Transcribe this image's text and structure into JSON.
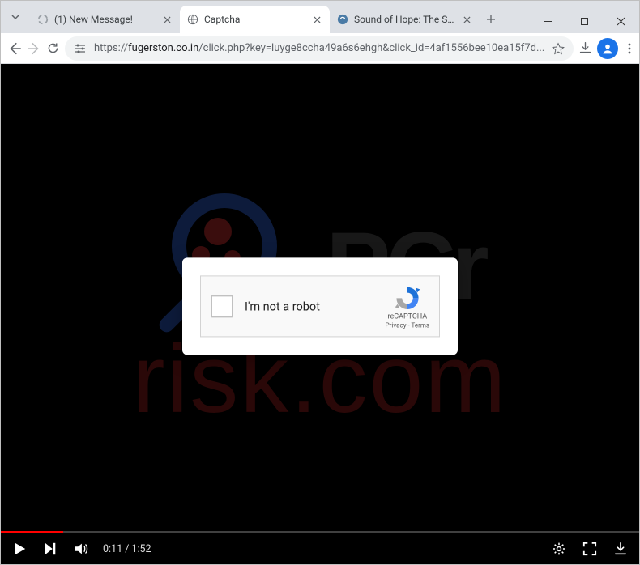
{
  "tabs": [
    {
      "title": "(1) New Message!",
      "active": false
    },
    {
      "title": "Captcha",
      "active": true
    },
    {
      "title": "Sound of Hope: The Story o",
      "active": false
    }
  ],
  "url": {
    "proto": "https://",
    "domain": "fugerston.co.in",
    "path": "/click.php?key=luyge8ccha49a6s6ehgh&click_id=4af1556bee10ea15f7d..."
  },
  "captcha": {
    "label": "I'm not a robot",
    "brand": "reCAPTCHA",
    "links": "Privacy - Terms"
  },
  "video": {
    "current": "0:11",
    "total": "1:52",
    "progress_pct": 9.8
  },
  "watermark": {
    "top": "PCr",
    "bottom": "risk.com"
  }
}
